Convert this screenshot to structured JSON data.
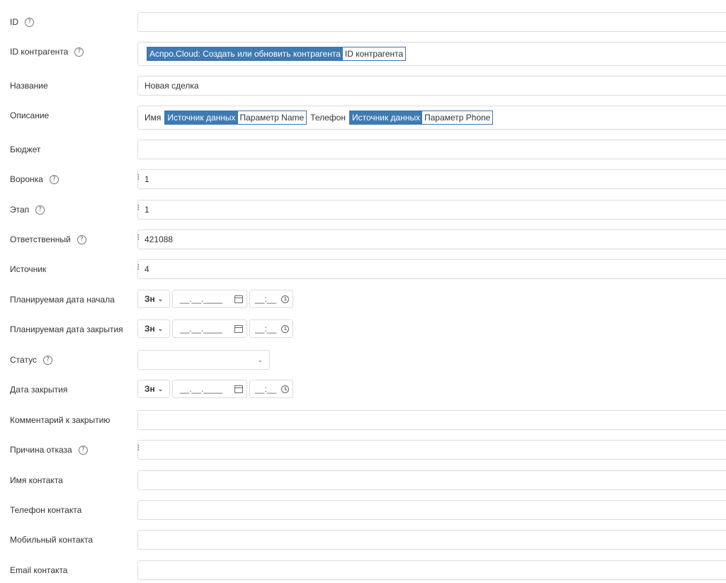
{
  "fields": {
    "id": {
      "label": "ID",
      "value": ""
    },
    "counterparty_id": {
      "label": "ID контрагента",
      "chip_key": "Аспро.Cloud: Создать или обновить контрагента",
      "chip_value": "ID контрагента"
    },
    "name": {
      "label": "Название",
      "value": "Новая сделка"
    },
    "description": {
      "label": "Описание",
      "text1": "Имя",
      "chip1_key": "Источник данных",
      "chip1_value": "Параметр Name",
      "text2": "Телефон",
      "chip2_key": "Источник данных",
      "chip2_value": "Параметр Phone"
    },
    "budget": {
      "label": "Бюджет",
      "value": ""
    },
    "funnel": {
      "label": "Воронка",
      "value": "1"
    },
    "stage": {
      "label": "Этап",
      "value": "1"
    },
    "responsible": {
      "label": "Ответственный",
      "value": "421088"
    },
    "source": {
      "label": "Источник",
      "value": "4"
    },
    "planned_start": {
      "label": "Планируемая дата начала"
    },
    "planned_close": {
      "label": "Планируемая дата закрытия"
    },
    "status": {
      "label": "Статус",
      "value": ""
    },
    "close_date": {
      "label": "Дата закрытия"
    },
    "close_comment": {
      "label": "Комментарий к закрытию",
      "value": ""
    },
    "reject_reason": {
      "label": "Причина отказа",
      "value": ""
    },
    "contact_name": {
      "label": "Имя контакта",
      "value": ""
    },
    "contact_phone": {
      "label": "Телефон контакта",
      "value": ""
    },
    "contact_mobile": {
      "label": "Мобильный контакта",
      "value": ""
    },
    "contact_email": {
      "label": "Email контакта",
      "value": ""
    }
  },
  "datetime": {
    "zone_label": "Зн",
    "date_placeholder": "__.__.____",
    "time_placeholder": "__:__"
  },
  "icons": {
    "help": "question-circle-icon",
    "chevron": "chevron-down-icon",
    "calendar": "calendar-icon",
    "clock": "clock-icon",
    "drag": "drag-handle-icon"
  },
  "colors": {
    "chip_bg": "#3e7ab3",
    "chip_border": "#3e76b0",
    "field_border": "#dcdcdc",
    "drag_dots": "#4b6fb0"
  }
}
